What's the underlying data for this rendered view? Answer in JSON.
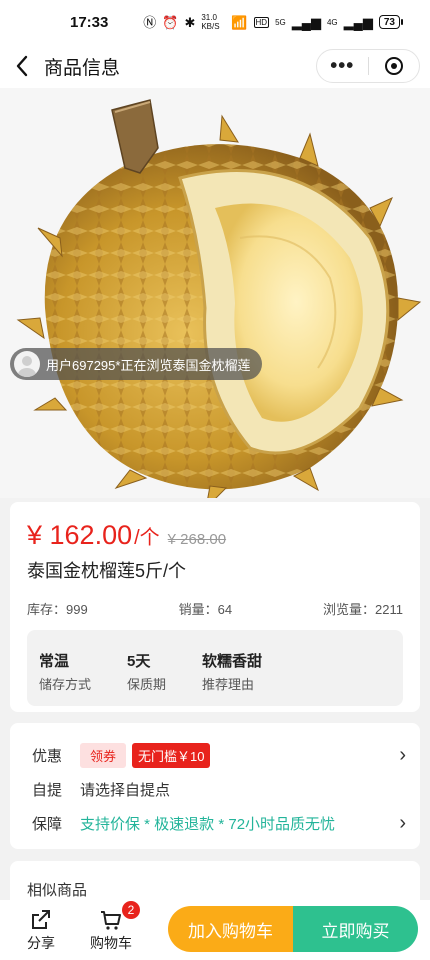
{
  "status_bar": {
    "time": "17:33",
    "network_speed": "31.0 KB/S",
    "hd_label": "HD",
    "signal_1": "5G",
    "signal_2": "4G",
    "battery": "73"
  },
  "nav": {
    "title": "商品信息"
  },
  "hero": {
    "image_name": "durian-product-photo",
    "viewer_toast": "用户697295*正在浏览泰国金枕榴莲"
  },
  "product": {
    "price": "¥ 162.00",
    "price_unit": "/个",
    "original_price": "¥ 268.00",
    "name": "泰国金枕榴莲5斤/个",
    "stats": {
      "stock": "库存：999",
      "sales": "销量：64",
      "views": "浏览量：2211"
    },
    "attributes": [
      {
        "value": "常温",
        "label": "储存方式"
      },
      {
        "value": "5天",
        "label": "保质期"
      },
      {
        "value": "软糯香甜",
        "label": "推荐理由"
      }
    ]
  },
  "promo": {
    "discount_key": "优惠",
    "coupon_label": "领券",
    "threshold_label": "无门槛￥10",
    "pickup_key": "自提",
    "pickup_value": "请选择自提点",
    "guarantee_key": "保障",
    "guarantee_value": "支持价保 * 极速退款 * 72小时品质无忧"
  },
  "similar": {
    "title": "相似商品"
  },
  "bottom_bar": {
    "share_label": "分享",
    "cart_label": "购物车",
    "cart_count": "2",
    "add_to_cart": "加入购物车",
    "buy_now": "立即购买"
  },
  "colors": {
    "price_red": "#e8231c",
    "accent_green": "#2ec18f",
    "accent_orange": "#fbab17",
    "guarantee_teal": "#23b49a"
  }
}
